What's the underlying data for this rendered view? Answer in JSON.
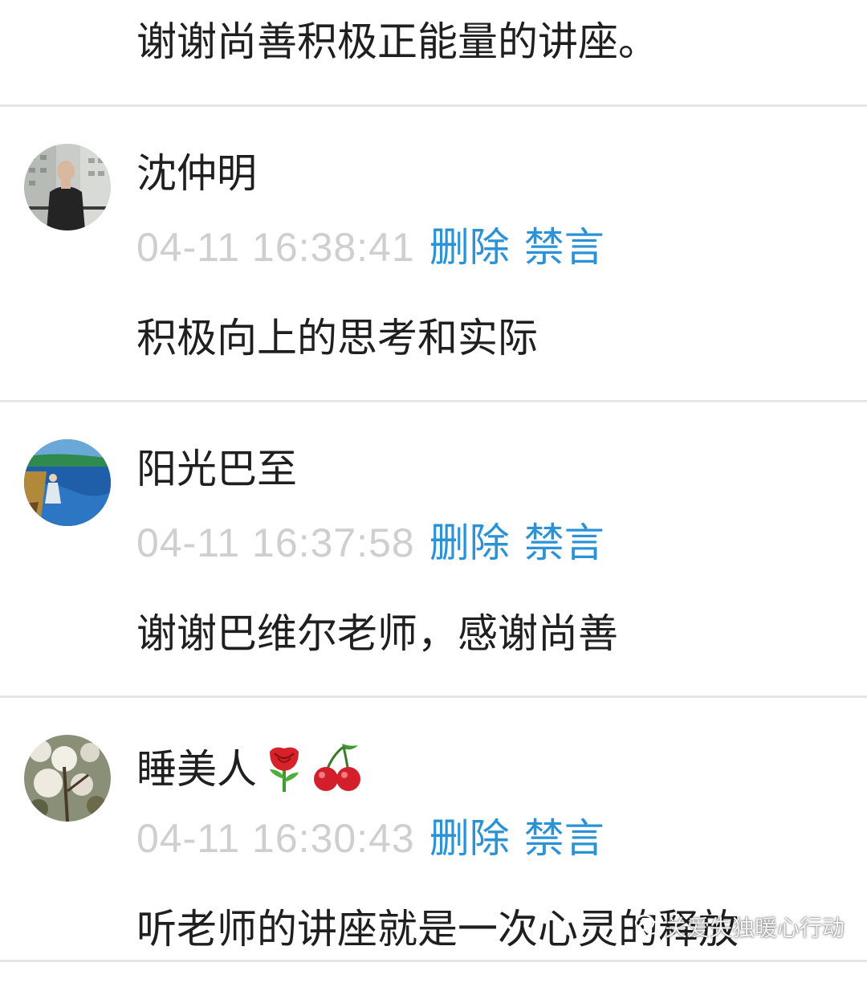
{
  "top_comment": {
    "text": "谢谢尚善积极正能量的讲座。"
  },
  "actions": {
    "delete_label": "删除",
    "ban_label": "禁言"
  },
  "comments": [
    {
      "name": "沈仲明",
      "timestamp": "04-11 16:38:41",
      "text": "积极向上的思考和实际",
      "emojis": []
    },
    {
      "name": "阳光巴至",
      "timestamp": "04-11 16:37:58",
      "text": "谢谢巴维尔老师，感谢尚善",
      "emojis": []
    },
    {
      "name": "睡美人",
      "timestamp": "04-11 16:30:43",
      "text": "听老师的讲座就是一次心灵的释放",
      "emojis": [
        "rose-emoji",
        "cherry-emoji"
      ]
    }
  ],
  "watermark": {
    "text": "关爱失独暖心行动",
    "icon": "wechat-icon"
  },
  "colors": {
    "action_blue": "#2a93d8",
    "timestamp_gray": "#cfcfcf",
    "divider": "#e6e6e6"
  }
}
